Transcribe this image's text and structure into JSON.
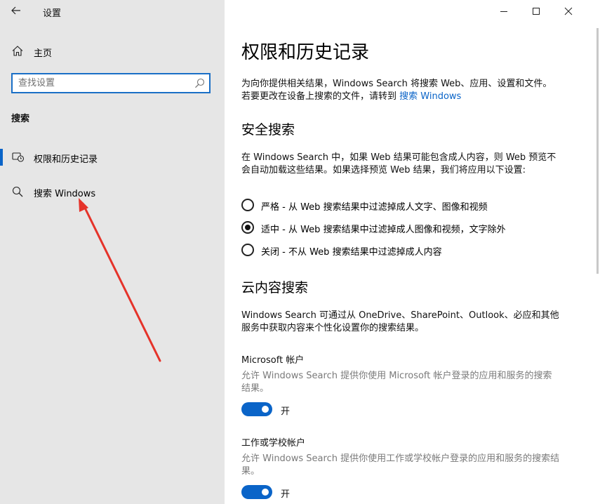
{
  "window": {
    "title": "设置"
  },
  "sidebar": {
    "home_label": "主页",
    "search_placeholder": "查找设置",
    "section_label": "搜索",
    "items": [
      {
        "label": "权限和历史记录",
        "selected": true
      },
      {
        "label": "搜索 Windows",
        "selected": false
      }
    ]
  },
  "main": {
    "title": "权限和历史记录",
    "intro_text": "为向你提供相关结果，Windows Search 将搜索 Web、应用、设置和文件。若要更改在设备上搜索的文件，请转到 ",
    "intro_link": "搜索 Windows",
    "safe_search": {
      "heading": "安全搜索",
      "description": "在 Windows Search 中，如果 Web 结果可能包含成人内容，则 Web 预览不会自动加载这些结果。如果选择预览 Web 结果，我们将应用以下设置:",
      "options": [
        {
          "label": "严格 - 从 Web 搜索结果中过滤掉成人文字、图像和视频",
          "checked": false
        },
        {
          "label": "适中 - 从 Web 搜索结果中过滤掉成人图像和视频，文字除外",
          "checked": true
        },
        {
          "label": "关闭 - 不从 Web 搜索结果中过滤掉成人内容",
          "checked": false
        }
      ]
    },
    "cloud_search": {
      "heading": "云内容搜索",
      "description": "Windows Search 可通过从 OneDrive、SharePoint、Outlook、必应和其他服务中获取内容来个性化设置你的搜索结果。",
      "accounts": [
        {
          "title": "Microsoft 帐户",
          "description": "允许 Windows Search 提供你使用 Microsoft 帐户登录的应用和服务的搜索结果。",
          "toggle_label": "开",
          "on": true
        },
        {
          "title": "工作或学校帐户",
          "description": "允许 Windows Search 提供你使用工作或学校帐户登录的应用和服务的搜索结果。",
          "toggle_label": "开",
          "on": true
        }
      ]
    }
  },
  "colors": {
    "accent": "#0a64c8",
    "sidebar_bg": "#e6e6e6",
    "annotation_arrow": "#e5332a"
  }
}
